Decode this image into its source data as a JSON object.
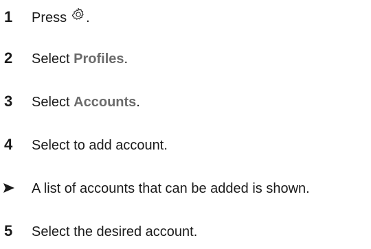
{
  "steps": [
    {
      "marker": "1",
      "prefix": "Press",
      "icon": "settings-gear-icon",
      "suffix": "."
    },
    {
      "marker": "2",
      "prefix": "Select ",
      "term": "Profiles",
      "suffix": "."
    },
    {
      "marker": "3",
      "prefix": "Select ",
      "term": "Accounts",
      "suffix": "."
    },
    {
      "marker": "4",
      "text": "Select to add account."
    },
    {
      "marker": ">",
      "text": "A list of accounts that can be added is shown."
    },
    {
      "marker": "5",
      "text": "Select the desired account."
    }
  ]
}
